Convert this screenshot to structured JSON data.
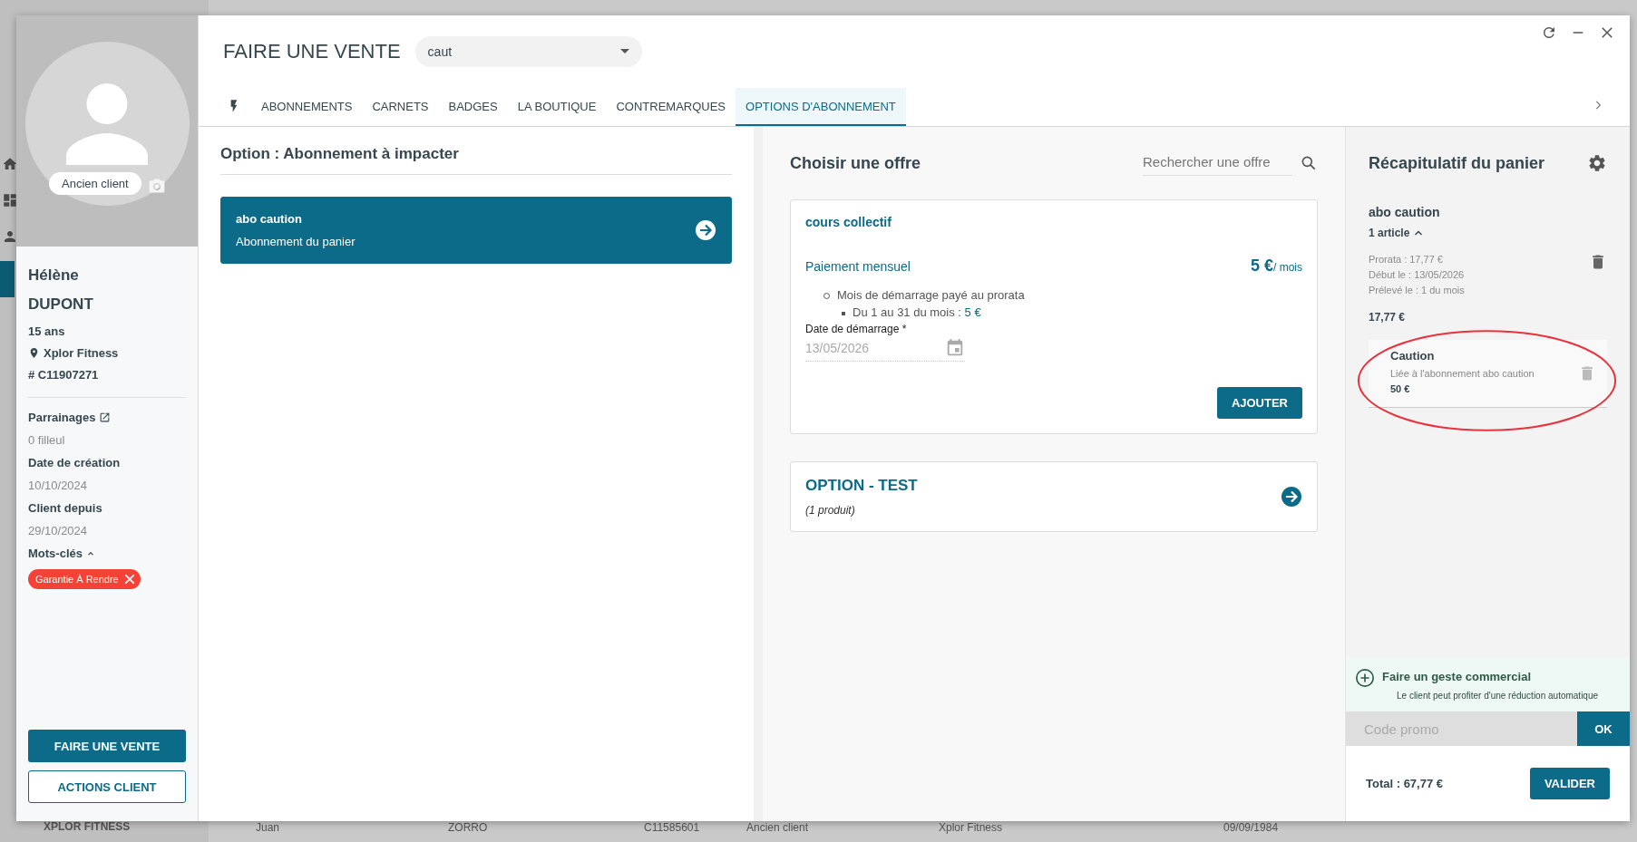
{
  "background": {
    "brand": "XPLOR FITNESS",
    "row": [
      "Juan",
      "ZORRO",
      "C11585601",
      "Ancien client",
      "Xplor Fitness",
      "09/09/1984"
    ]
  },
  "client": {
    "status": "Ancien client",
    "first_name": "Hélène",
    "last_name": "DUPONT",
    "age": "15 ans",
    "location": "Xplor Fitness",
    "number": "# C11907271",
    "fields": [
      {
        "label": "Parrainages",
        "value": "0 filleul",
        "kind": "link"
      },
      {
        "label": "Date de création",
        "value": "10/10/2024",
        "kind": "plain"
      },
      {
        "label": "Client depuis",
        "value": "29/10/2024",
        "kind": "plain"
      }
    ],
    "keywords_label": "Mots-clés",
    "keywords_expanded": true,
    "tags": [
      {
        "label": "Garantie À Rendre"
      }
    ],
    "buttons": [
      {
        "label": "FAIRE UNE VENTE",
        "kind": "primary"
      },
      {
        "label": "ACTIONS CLIENT",
        "kind": "outline"
      }
    ]
  },
  "header": {
    "title": "FAIRE UNE VENTE",
    "search_value": "caut"
  },
  "tabs": [
    {
      "kind": "icon",
      "selected": false
    },
    {
      "kind": "text",
      "label": "ABONNEMENTS",
      "selected": false
    },
    {
      "kind": "text",
      "label": "CARNETS",
      "selected": false
    },
    {
      "kind": "text",
      "label": "BADGES",
      "selected": false
    },
    {
      "kind": "text",
      "label": "LA BOUTIQUE",
      "selected": false
    },
    {
      "kind": "text",
      "label": "CONTREMARQUES",
      "selected": false
    },
    {
      "kind": "text",
      "label": "OPTIONS D'ABONNEMENT",
      "selected": true
    }
  ],
  "option_panel": {
    "title": "Option : Abonnement à impacter",
    "cards": [
      {
        "name": "abo caution",
        "subtitle": "Abonnement du panier",
        "selected": true
      }
    ]
  },
  "offers": {
    "title": "Choisir une offre",
    "search_placeholder": "Rechercher une offre",
    "items": [
      {
        "kind": "detail",
        "name": "cours collectif",
        "payment": "Paiement mensuel",
        "price": "5 €",
        "period": "/ mois",
        "notes": [
          {
            "text": "Mois de démarrage payé au prorata",
            "children": [
              {
                "text": "Du 1 au 31 du mois : ",
                "amount": "5 €"
              }
            ]
          }
        ],
        "date_label": "Date de démarrage *",
        "date_value": "13/05/2026",
        "button": "AJOUTER"
      },
      {
        "kind": "group",
        "name": "OPTION - TEST",
        "count": "(1 produit)"
      }
    ]
  },
  "cart": {
    "title": "Récapitulatif du panier",
    "items": [
      {
        "name": "abo caution",
        "count": "1 article",
        "expanded": true,
        "lines": [
          "Prorata : 17,77 €",
          "Début le : 13/05/2026",
          "Prélevé le : 1 du mois"
        ],
        "price": "17,77 €",
        "sub_items": [
          {
            "name": "Caution",
            "description": "Liée à l'abonnement abo caution",
            "price": "50 €",
            "highlighted": true
          }
        ]
      }
    ],
    "gesture": {
      "title": "Faire un geste commercial",
      "subtitle": "Le client peut profiter d'une réduction automatique"
    },
    "promo_placeholder": "Code promo",
    "promo_button": "OK",
    "total": "Total : 67,77 €",
    "validate": "VALIDER"
  }
}
